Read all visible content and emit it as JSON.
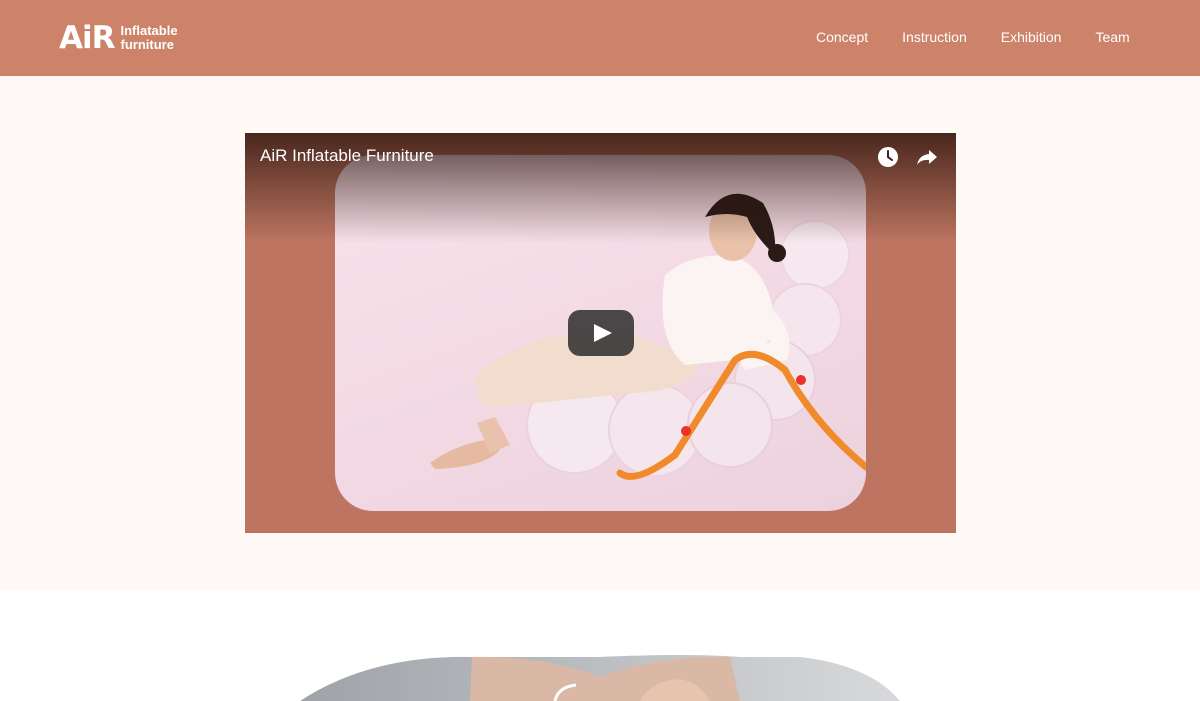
{
  "header": {
    "logo": {
      "mark": "AiR",
      "line1": "Inflatable",
      "line2": "furniture"
    },
    "nav": [
      {
        "label": "Concept"
      },
      {
        "label": "Instruction"
      },
      {
        "label": "Exhibition"
      },
      {
        "label": "Team"
      }
    ],
    "background_color": "#cd8369"
  },
  "video": {
    "title": "AiR Inflatable Furniture",
    "icons": [
      "watch-later-icon",
      "share-icon",
      "play-icon"
    ],
    "background_color": "#bd7561"
  },
  "page": {
    "section_background": "#fef9f6"
  }
}
